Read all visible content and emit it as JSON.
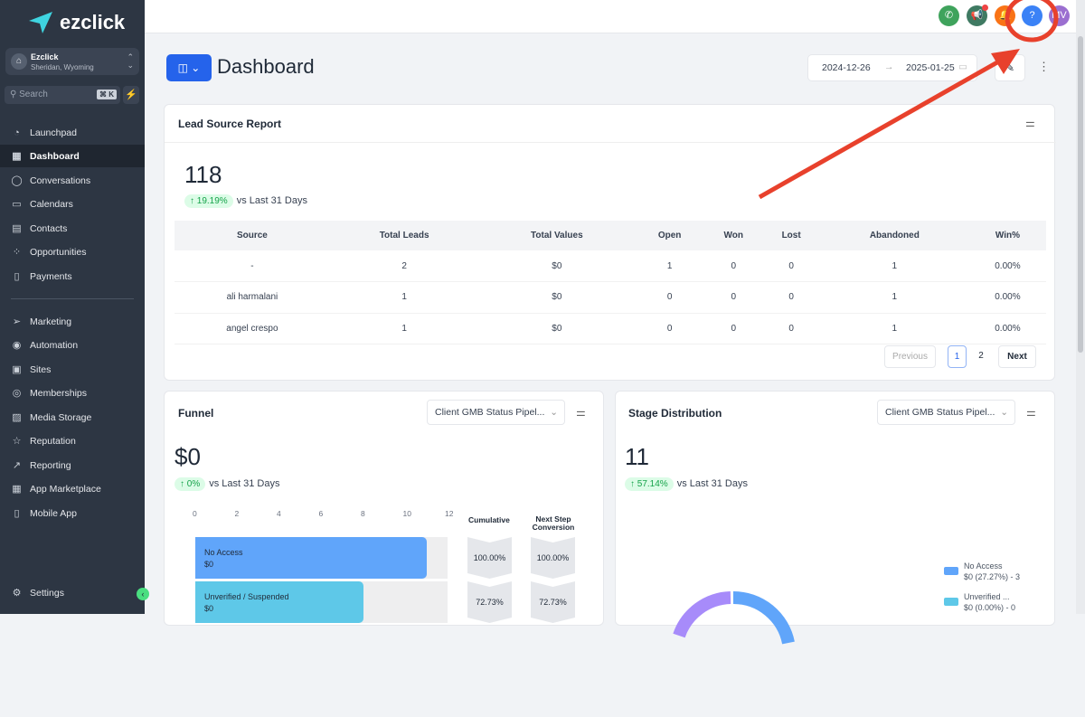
{
  "sidebar": {
    "brand": "ezclick",
    "location_name": "Ezclick",
    "location_sub": "Sheridan, Wyoming",
    "search_placeholder": "Search",
    "search_shortcut": "⌘ K",
    "items": [
      {
        "label": "Launchpad",
        "icon": "rocket-icon"
      },
      {
        "label": "Dashboard",
        "icon": "grid-icon"
      },
      {
        "label": "Conversations",
        "icon": "chat-icon"
      },
      {
        "label": "Calendars",
        "icon": "calendar-icon"
      },
      {
        "label": "Contacts",
        "icon": "contacts-icon"
      },
      {
        "label": "Opportunities",
        "icon": "opportunities-icon"
      },
      {
        "label": "Payments",
        "icon": "payments-icon"
      }
    ],
    "items2": [
      {
        "label": "Marketing"
      },
      {
        "label": "Automation"
      },
      {
        "label": "Sites"
      },
      {
        "label": "Memberships"
      },
      {
        "label": "Media Storage"
      },
      {
        "label": "Reputation"
      },
      {
        "label": "Reporting"
      },
      {
        "label": "App Marketplace"
      },
      {
        "label": "Mobile App"
      }
    ],
    "settings": "Settings"
  },
  "topbar": {
    "help": "?",
    "avatar": "MV"
  },
  "page": {
    "title": "Dashboard",
    "date_from": "2024-12-26",
    "date_to": "2025-01-25"
  },
  "lead_report": {
    "title": "Lead Source Report",
    "total": "118",
    "change": "↑ 19.19%",
    "vs": "vs Last 31 Days",
    "columns": [
      "Source",
      "Total Leads",
      "Total Values",
      "Open",
      "Won",
      "Lost",
      "Abandoned",
      "Win%"
    ],
    "rows": [
      [
        "-",
        "2",
        "$0",
        "1",
        "0",
        "0",
        "1",
        "0.00%"
      ],
      [
        "ali harmalani",
        "1",
        "$0",
        "0",
        "0",
        "0",
        "1",
        "0.00%"
      ],
      [
        "angel crespo",
        "1",
        "$0",
        "0",
        "0",
        "0",
        "1",
        "0.00%"
      ]
    ],
    "pagination": {
      "previous": "Previous",
      "pages": [
        "1",
        "2"
      ],
      "next": "Next"
    }
  },
  "funnel": {
    "title": "Funnel",
    "pipeline": "Client GMB Status Pipel...",
    "total": "$0",
    "change": "↑ 0%",
    "vs": "vs Last 31 Days",
    "axis": [
      "0",
      "2",
      "4",
      "6",
      "8",
      "10",
      "12"
    ],
    "cumulative_label": "Cumulative",
    "next_label": "Next Step Conversion",
    "stages": [
      {
        "name": "No Access",
        "value": "$0",
        "count": 11,
        "cumulative": "100.00%",
        "next": "100.00%",
        "color": "#60a5fa"
      },
      {
        "name": "Unverified / Suspended",
        "value": "$0",
        "count": 8,
        "cumulative": "72.73%",
        "next": "72.73%",
        "color": "#5ec8e8"
      }
    ]
  },
  "stage": {
    "title": "Stage Distribution",
    "pipeline": "Client GMB Status Pipel...",
    "total": "11",
    "change": "↑ 57.14%",
    "vs": "vs Last 31 Days",
    "legend": [
      {
        "name": "No Access",
        "detail": "$0 (27.27%) - 3",
        "color": "#60a5fa"
      },
      {
        "name": "Unverified ...",
        "detail": "$0 (0.00%) - 0",
        "color": "#5ec8e8"
      }
    ]
  }
}
